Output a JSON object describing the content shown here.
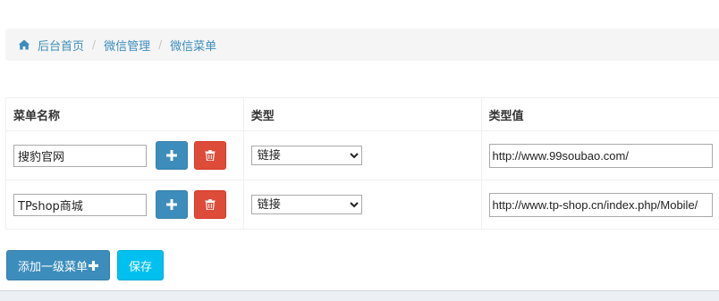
{
  "breadcrumb": {
    "items": [
      "后台首页",
      "微信管理",
      "微信菜单"
    ],
    "separator": "/",
    "icon": "home-icon"
  },
  "table": {
    "headers": [
      "菜单名称",
      "类型",
      "类型值"
    ],
    "rows": [
      {
        "name": "搜豹官网",
        "type": "链接",
        "value": "http://www.99soubao.com/"
      },
      {
        "name": "TPshop商城",
        "type": "链接",
        "value": "http://www.tp-shop.cn/index.php/Mobile/"
      }
    ],
    "add_icon": "plus-icon",
    "delete_icon": "trash-icon"
  },
  "actions": {
    "add_top_menu_label": "添加一级菜单",
    "add_top_menu_icon": "plus-icon",
    "save_label": "保存"
  },
  "colors": {
    "primary": "#3c8dbc",
    "danger": "#dd4b39",
    "info": "#00c0ef",
    "breadcrumb_bg": "#f5f5f5"
  }
}
